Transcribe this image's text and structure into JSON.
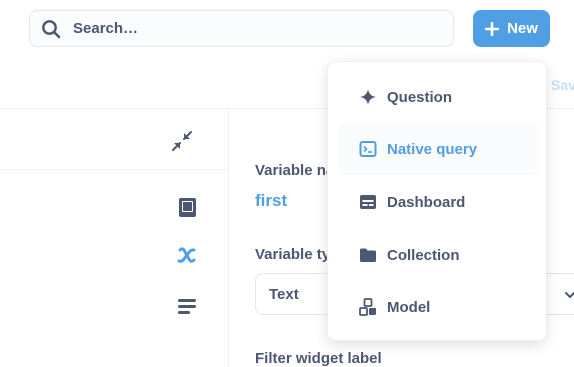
{
  "search": {
    "placeholder": "Search…"
  },
  "new_button": {
    "label": "New"
  },
  "toolbar": {
    "save_label": "Save"
  },
  "new_menu": {
    "items": [
      {
        "label": "Question",
        "icon": "sparkle-icon"
      },
      {
        "label": "Native query",
        "icon": "sql-icon",
        "active": true
      },
      {
        "label": "Dashboard",
        "icon": "dashboard-icon"
      },
      {
        "label": "Collection",
        "icon": "folder-icon"
      },
      {
        "label": "Model",
        "icon": "model-icon"
      }
    ]
  },
  "editor_sidebar": {
    "icons": [
      "contract-icon",
      "reference-icon",
      "variables-icon",
      "snippets-icon"
    ]
  },
  "variable_panel": {
    "name_label": "Variable name",
    "name_value": "first",
    "type_label": "Variable type",
    "type_value": "Text",
    "filter_label": "Filter widget label"
  },
  "colors": {
    "brand": "#509ee3",
    "text_dark": "#4c5773",
    "border": "#e3e6ea"
  }
}
